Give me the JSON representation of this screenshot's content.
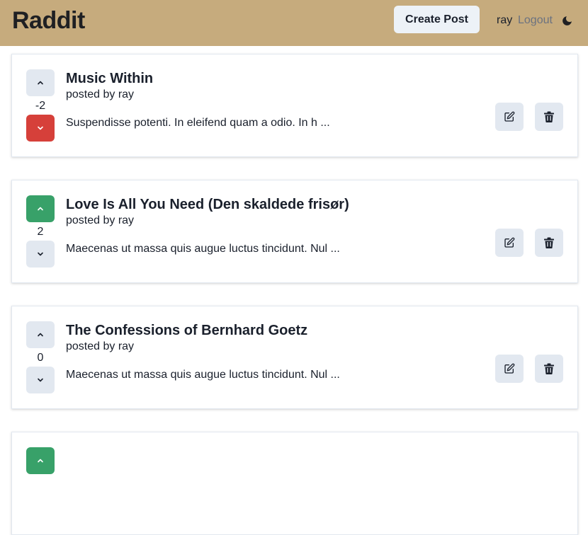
{
  "app": {
    "brand": "Raddit"
  },
  "header": {
    "create_post_label": "Create Post",
    "username": "ray",
    "logout_label": "Logout",
    "theme_icon": "moon-icon"
  },
  "colors": {
    "navbar": "#c6ab7d",
    "upvote_active": "#38a169",
    "downvote_active": "#d6403a",
    "button_bg": "#e2e8f0"
  },
  "posts": [
    {
      "title": "Music Within",
      "author_line": "posted by ray",
      "excerpt": "Suspendisse potenti. In eleifend quam a odio. In h ...",
      "score": "-2",
      "vote_state": "down"
    },
    {
      "title": "Love Is All You Need (Den skaldede frisør)",
      "author_line": "posted by ray",
      "excerpt": "Maecenas ut massa quis augue luctus tincidunt. Nul ...",
      "score": "2",
      "vote_state": "up"
    },
    {
      "title": "The Confessions of Bernhard Goetz",
      "author_line": "posted by ray",
      "excerpt": "Maecenas ut massa quis augue luctus tincidunt. Nul ...",
      "score": "0",
      "vote_state": "none"
    },
    {
      "title": "",
      "author_line": "",
      "excerpt": "",
      "score": "",
      "vote_state": "up"
    }
  ]
}
